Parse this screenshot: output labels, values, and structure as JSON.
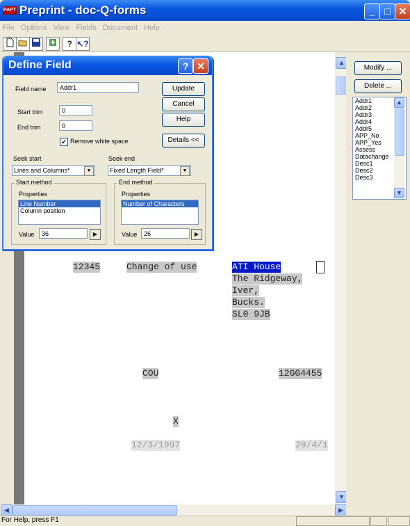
{
  "window": {
    "title": "Preprint - doc-Q-forms",
    "icon_label": "PAPT",
    "min": "_",
    "max": "□",
    "close": "✕"
  },
  "menu": [
    "File",
    "Options",
    "View",
    "Fields",
    "Document",
    "Help"
  ],
  "toolbar": {
    "icons": [
      "new-icon",
      "open-icon",
      "save-icon",
      "export-icon",
      "help-icon",
      "context-help-icon"
    ]
  },
  "document": {
    "lines": [
      {
        "text": "12345"
      },
      {
        "text": "Change of use"
      },
      {
        "text": "ATI House"
      },
      {
        "text": "The Ridgeway,"
      },
      {
        "text": "Iver,"
      },
      {
        "text": "Bucks."
      },
      {
        "text": "SL0 9JB"
      },
      {
        "text": "COU"
      },
      {
        "text": "12GG4455"
      },
      {
        "text": "X"
      },
      {
        "text": "12/3/1997"
      },
      {
        "text": "20/4/1"
      }
    ]
  },
  "right_panel": {
    "modify": "Modify ...",
    "delete": "Delete ...",
    "fields": [
      "Addr1",
      "Addr2",
      "Addr3",
      "Addr4",
      "Addr5",
      "APP_No",
      "APP_Yes",
      "Assess",
      "Datachange",
      "Desc1",
      "Desc2",
      "Desc3"
    ]
  },
  "status": {
    "text": "For Help, press F1"
  },
  "dialog": {
    "title": "Define Field",
    "help": "?",
    "close": "✕",
    "field_name_label": "Field name",
    "field_name_value": "Addr1",
    "start_trim_label": "Start trim",
    "start_trim_value": "0",
    "end_trim_label": "End trim",
    "end_trim_value": "0",
    "remove_ws_label": "Remove white space",
    "remove_ws_checked": "✔",
    "update": "Update",
    "cancel": "Cancel",
    "help_btn": "Help",
    "details": "Details <<",
    "seek_start_label": "Seek start",
    "seek_start_value": "Lines and Columns*",
    "seek_end_label": "Seek end",
    "seek_end_value": "Fixed Length Field*",
    "start_method_label": "Start method",
    "end_method_label": "End method",
    "start_props_label": "Properties",
    "end_props_label": "Properties",
    "start_props": [
      "Line Number",
      "Column position"
    ],
    "end_props": [
      "Number of Characters"
    ],
    "start_value_label": "Value",
    "start_value": "36",
    "end_value_label": "Value",
    "end_value": "26"
  }
}
